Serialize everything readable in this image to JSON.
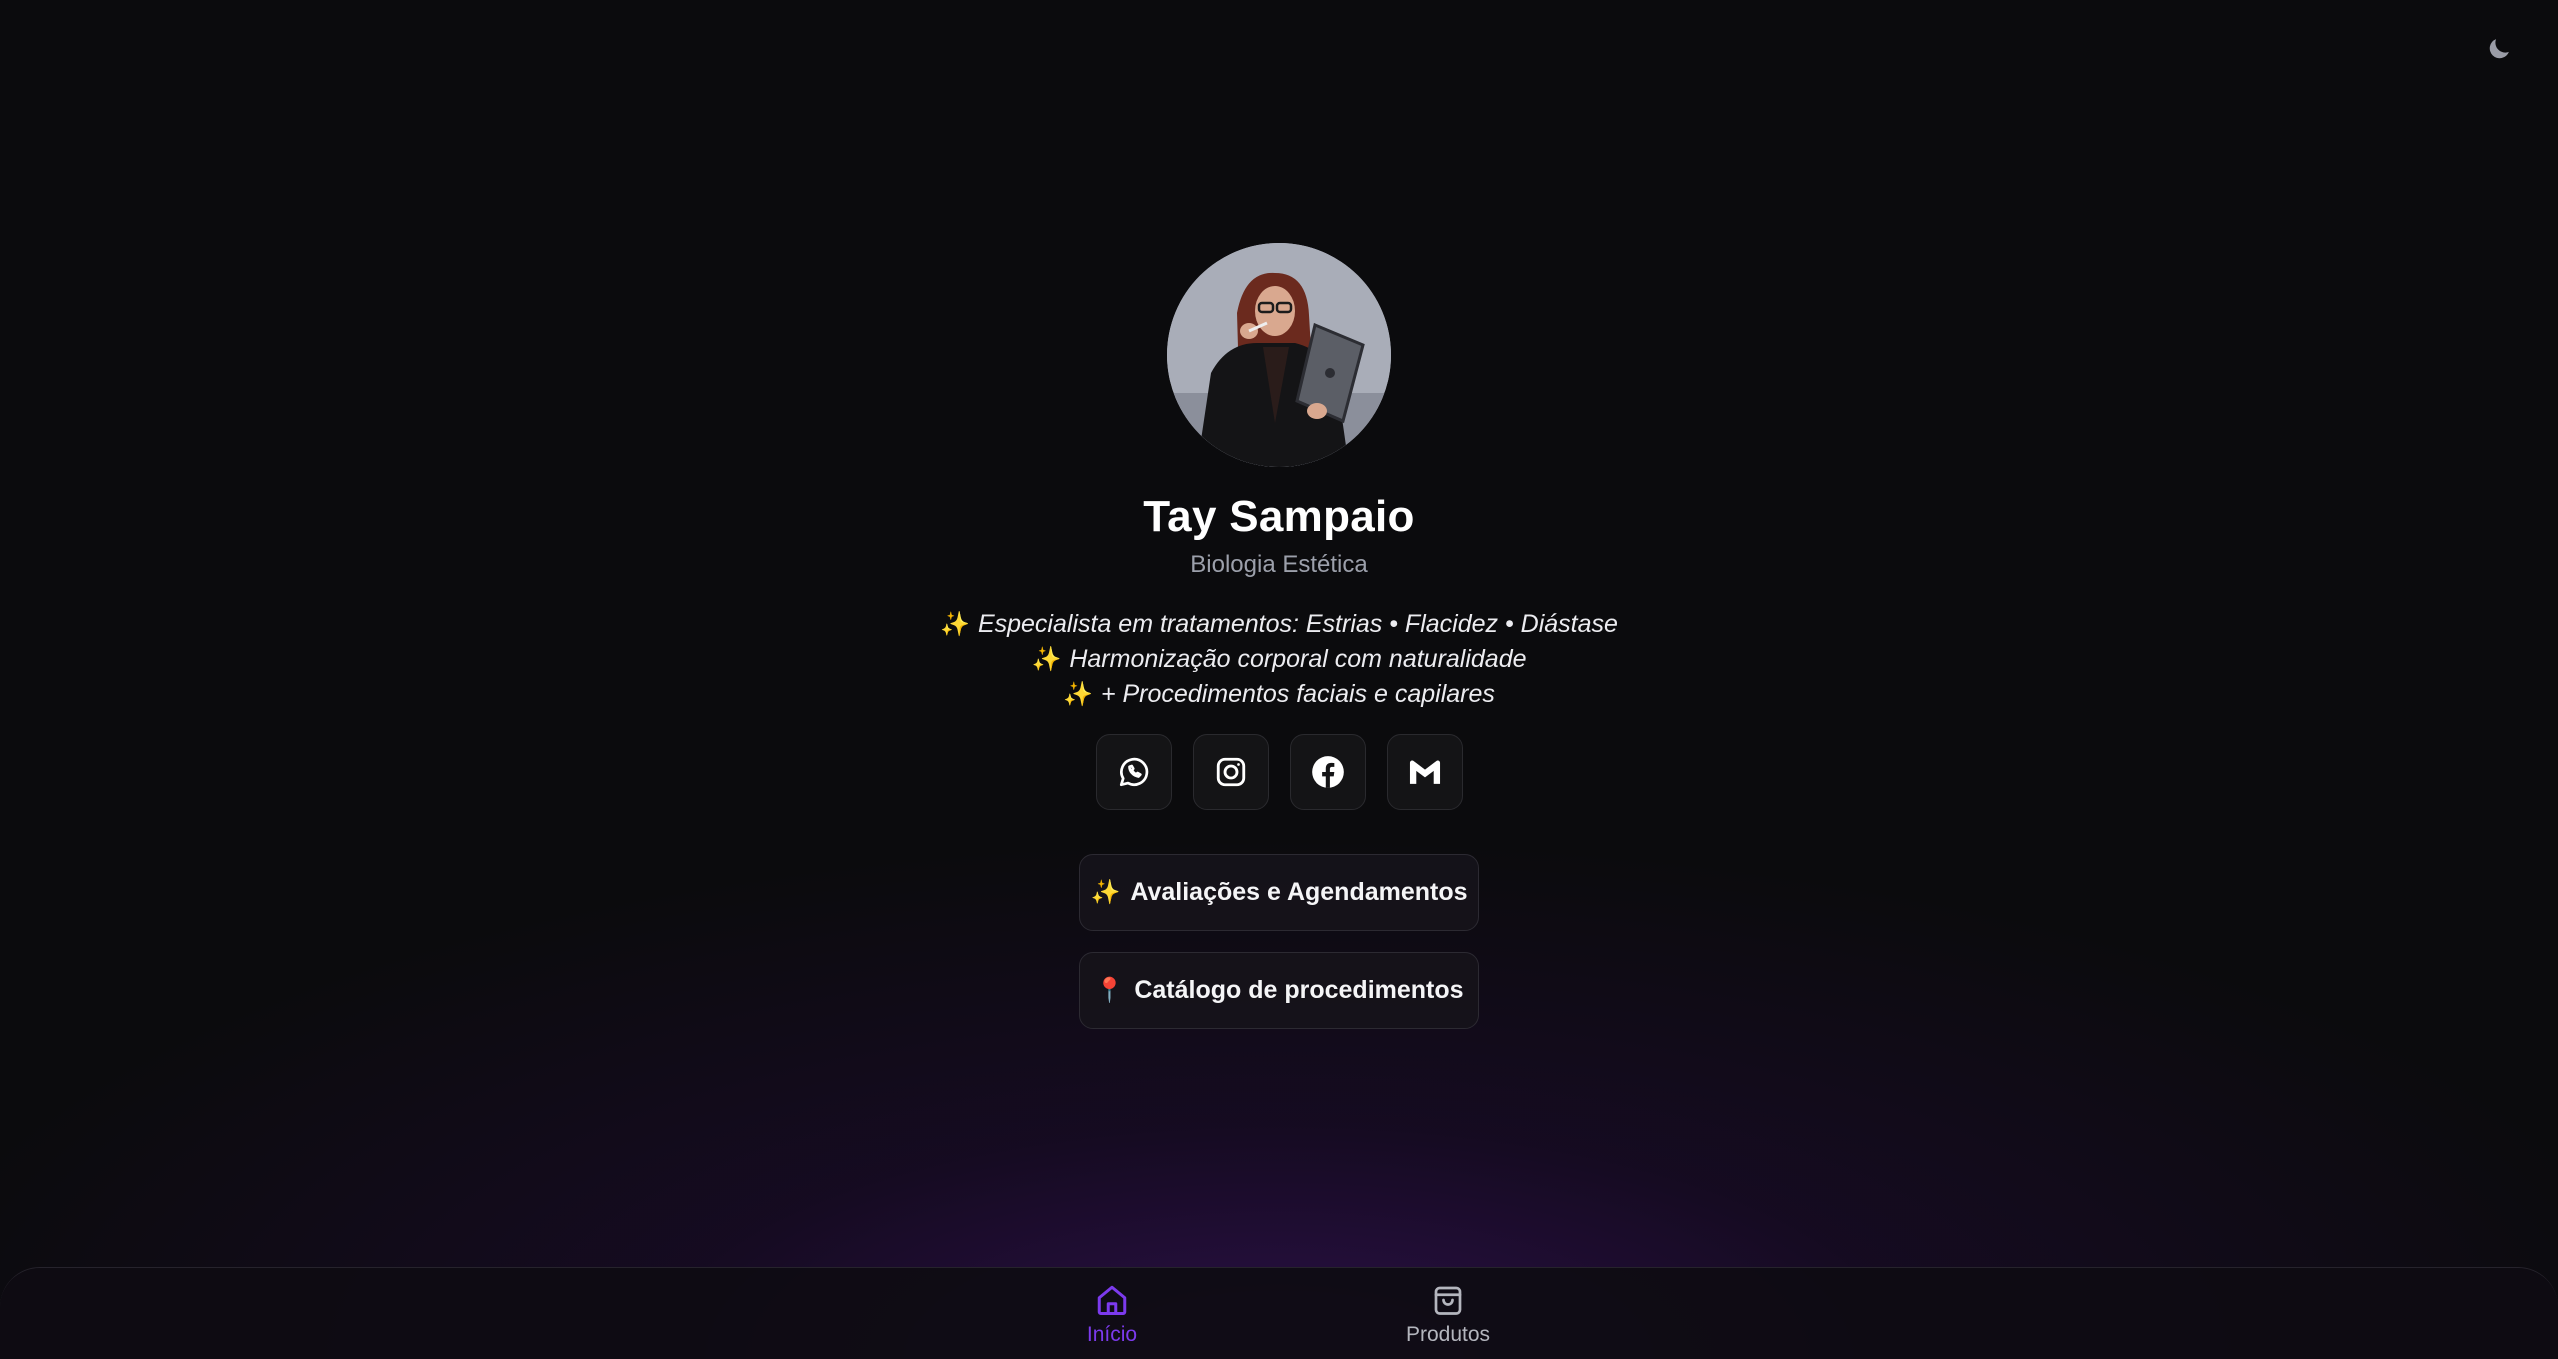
{
  "profile": {
    "name": "Tay Sampaio",
    "subtitle": "Biologia Estética",
    "bio": [
      {
        "emoji": "✨",
        "text": "Especialista em tratamentos: Estrias • Flacidez • Diástase"
      },
      {
        "emoji": "✨",
        "text": "Harmonização corporal com naturalidade"
      },
      {
        "emoji": "✨",
        "text": "+ Procedimentos faciais e capilares"
      }
    ]
  },
  "socials": [
    {
      "icon": "whatsapp-icon"
    },
    {
      "icon": "instagram-icon"
    },
    {
      "icon": "facebook-icon"
    },
    {
      "icon": "gmail-icon"
    }
  ],
  "links": [
    {
      "emoji": "✨",
      "label": "Avaliações e Agendamentos"
    },
    {
      "emoji": "📍",
      "label": "Catálogo de procedimentos"
    }
  ],
  "nav": {
    "items": [
      {
        "label": "Início",
        "icon": "home-icon",
        "active": true
      },
      {
        "label": "Produtos",
        "icon": "shopping-bag-icon",
        "active": false
      }
    ]
  },
  "theme": {
    "toggle_icon": "moon-icon"
  },
  "colors": {
    "background": "#0b0b0d",
    "accent": "#7c3aed",
    "muted_text": "#9ca0ab",
    "sparkle": "#f0b26a"
  }
}
